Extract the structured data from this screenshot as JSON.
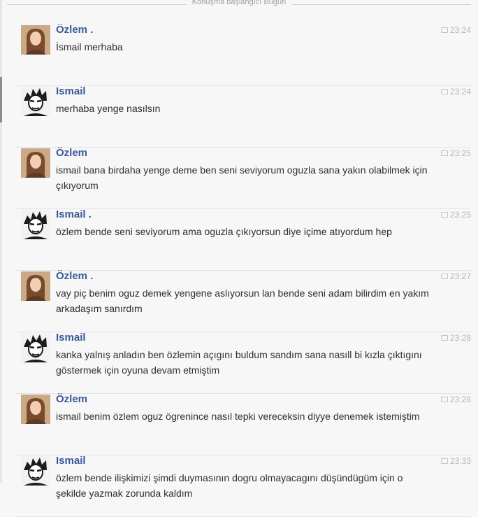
{
  "header": {
    "label": "Konuşma başlangıcı Bugün"
  },
  "messages": [
    {
      "sender": "Özlem .",
      "avatar": "female-profile-photo",
      "time": "23:24",
      "text": "İsmail merhaba"
    },
    {
      "sender": "Ismail",
      "avatar": "male-profile-photo",
      "time": "23:24",
      "text": "merhaba yenge nasılsın"
    },
    {
      "sender": "Özlem",
      "avatar": "female-profile-photo",
      "time": "23:25",
      "text": "ismail bana birdaha yenge deme ben seni seviyorum oguzla sana yakın olabilmek için çıkıyorum"
    },
    {
      "sender": "Ismail .",
      "avatar": "male-profile-photo",
      "time": "23:25",
      "text": "özlem bende seni seviyorum ama oguzla çıkıyorsun diye içime atıyordum hep"
    },
    {
      "sender": "Özlem .",
      "avatar": "female-profile-photo",
      "time": "23:27",
      "text": "vay piç benim oguz demek yengene aslıyorsun lan bende seni adam bilirdim en yakım arkadaşım sanırdım"
    },
    {
      "sender": "Ismail",
      "avatar": "male-profile-photo",
      "time": "23:28",
      "text": "kanka yalnış anladın ben özlemin açıgını buldum sandım sana nasıll bi kızla çıktıgını göstermek için oyuna devam etmiştim"
    },
    {
      "sender": "Özlem",
      "avatar": "female-profile-photo",
      "time": "23:28",
      "text": "ismail benim özlem oguz ögrenince nasıl tepki vereceksin diyye denemek istemiştim"
    },
    {
      "sender": "Ismail",
      "avatar": "male-profile-photo",
      "time": "23:33",
      "text": "özlem bende ilişkimizi şimdi duymasının dogru olmayacagını düşündügüm için o şekilde yazmak zorunda kaldım"
    }
  ],
  "colors": {
    "name": "#3b5998",
    "text": "#2e2e2e",
    "time": "#b5b5b5"
  }
}
